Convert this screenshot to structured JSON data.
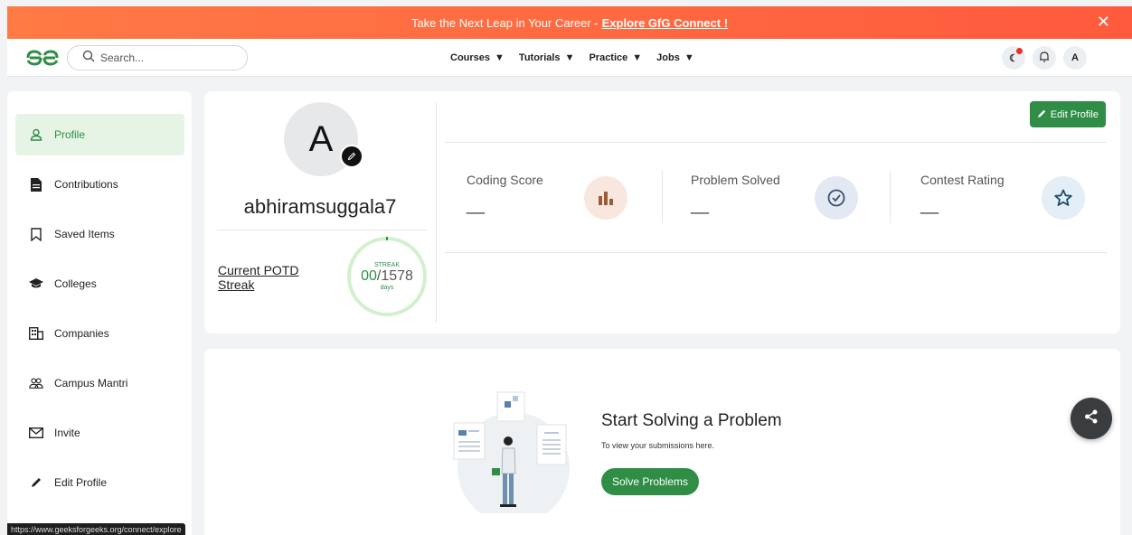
{
  "banner": {
    "text": "Take the Next Leap in Your Career - ",
    "link": "Explore GfG Connect !"
  },
  "search": {
    "placeholder": "Search..."
  },
  "nav": [
    {
      "label": "Courses"
    },
    {
      "label": "Tutorials"
    },
    {
      "label": "Practice"
    },
    {
      "label": "Jobs"
    }
  ],
  "user": {
    "initial": "A",
    "username": "abhiramsuggala7"
  },
  "sidebar": {
    "items": [
      {
        "label": "Profile",
        "icon": "user-icon"
      },
      {
        "label": "Contributions",
        "icon": "document-icon"
      },
      {
        "label": "Saved Items",
        "icon": "bookmark-icon"
      },
      {
        "label": "Colleges",
        "icon": "graduation-cap-icon"
      },
      {
        "label": "Companies",
        "icon": "building-icon"
      },
      {
        "label": "Campus Mantri",
        "icon": "users-icon"
      },
      {
        "label": "Invite",
        "icon": "envelope-icon"
      },
      {
        "label": "Edit Profile",
        "icon": "pencil-icon"
      }
    ]
  },
  "potd": {
    "label": "Current POTD Streak",
    "streak_label": "STREAK",
    "current": "00",
    "total": "/1578",
    "unit": "days",
    "progress": 0
  },
  "profile": {
    "edit_label": "Edit Profile"
  },
  "stats": [
    {
      "label": "Coding Score",
      "value": "__"
    },
    {
      "label": "Problem Solved",
      "value": "__"
    },
    {
      "label": "Contest Rating",
      "value": "__"
    }
  ],
  "empty_state": {
    "title": "Start Solving a Problem",
    "subtitle": "To view your submissions here.",
    "button": "Solve Problems"
  },
  "status_url": "https://www.geeksforgeeks.org/connect/explore",
  "colors": {
    "brand_green": "#2f8d46",
    "banner_orange": "#ff6a3d"
  }
}
